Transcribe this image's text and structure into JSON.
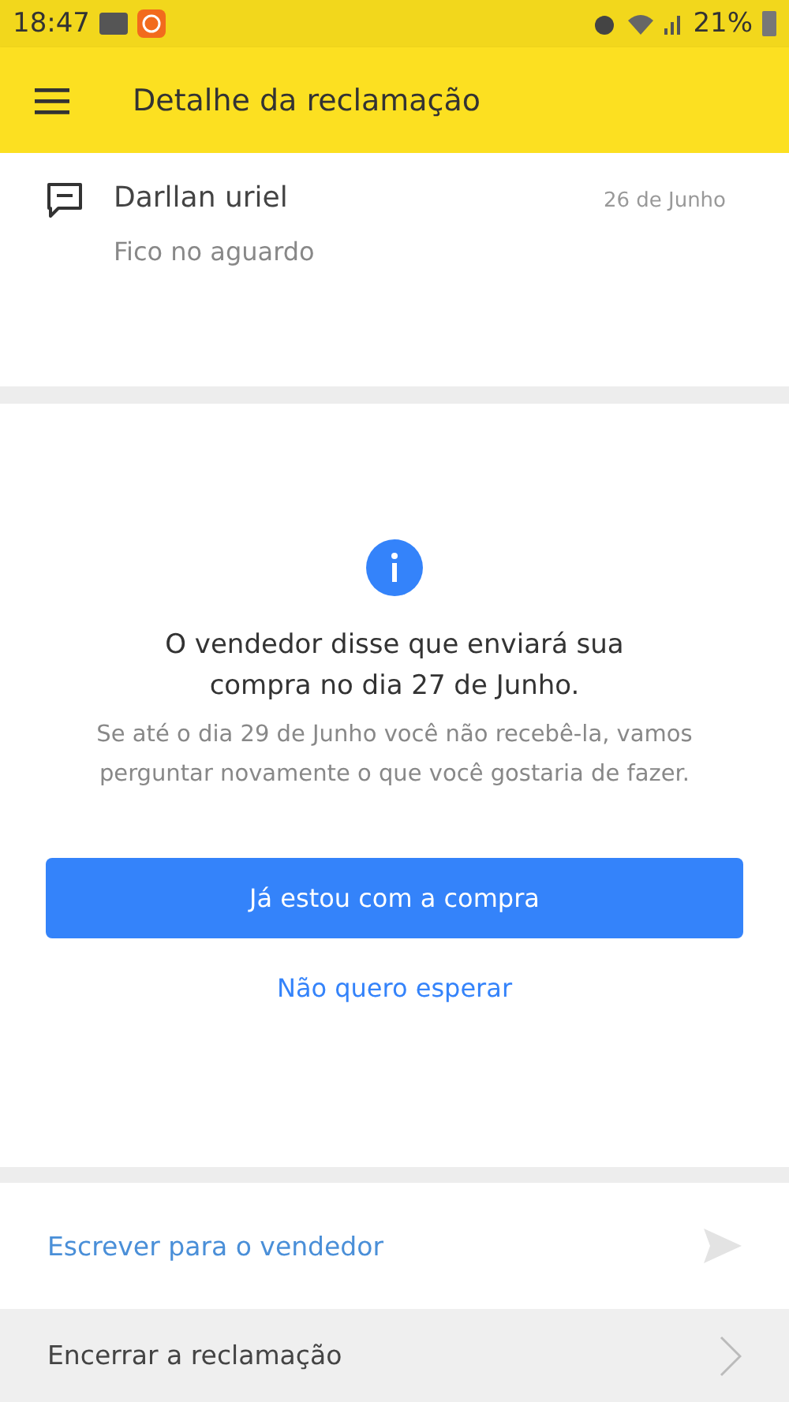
{
  "status_bar": {
    "time": "18:47",
    "battery": "21%"
  },
  "toolbar": {
    "title": "Detalhe da reclamação"
  },
  "message": {
    "author": "Darllan uriel",
    "date": "26 de Junho",
    "text": "Fico no aguardo"
  },
  "info": {
    "title": "O vendedor disse que enviará sua compra no dia 27 de Junho.",
    "text": "Se até o dia 29 de Junho você não recebê-la, vamos perguntar novamente o que você gostaria de fazer.",
    "primary_button": "Já estou com a compra",
    "secondary_link": "Não quero esperar"
  },
  "actions": [
    {
      "label": "Escrever para o vendedor",
      "kind": "send"
    },
    {
      "label": "Encerrar a reclamação",
      "kind": "chevron"
    }
  ]
}
